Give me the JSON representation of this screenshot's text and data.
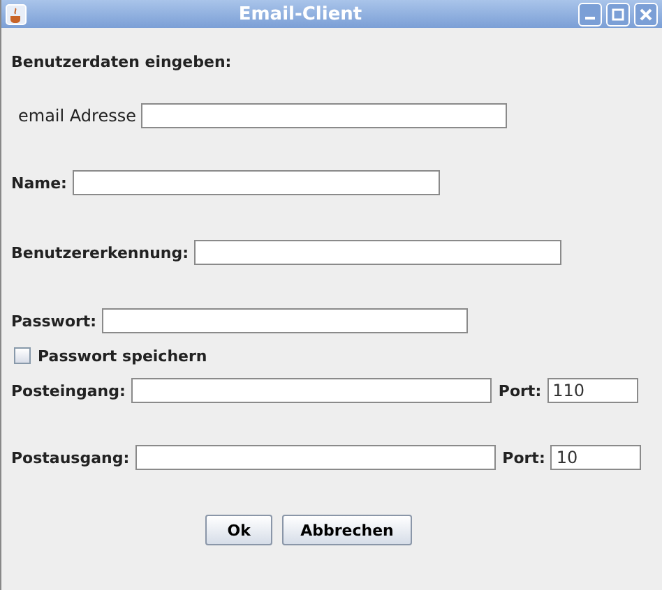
{
  "window": {
    "title": "Email-Client"
  },
  "heading": "Benutzerdaten eingeben:",
  "fields": [
    {
      "kind": "text",
      "label": "email Adresse",
      "bold": false
    },
    {
      "kind": "text",
      "label": "Name:",
      "bold": true
    },
    {
      "kind": "text",
      "label": "Benutzererkennung:",
      "bold": true
    },
    {
      "kind": "text",
      "label": "Passwort:",
      "bold": true
    },
    {
      "kind": "checkbox",
      "label": "Passwort speichern",
      "checked": false
    },
    {
      "kind": "server",
      "label": "Posteingang:",
      "bold": true,
      "port_label": "Port:",
      "port_value": "110"
    },
    {
      "kind": "server",
      "label": "Postausgang:",
      "bold": true,
      "port_label": "Port:",
      "port_value": "10"
    }
  ],
  "buttons": [
    "Ok",
    "Abbrechen"
  ]
}
